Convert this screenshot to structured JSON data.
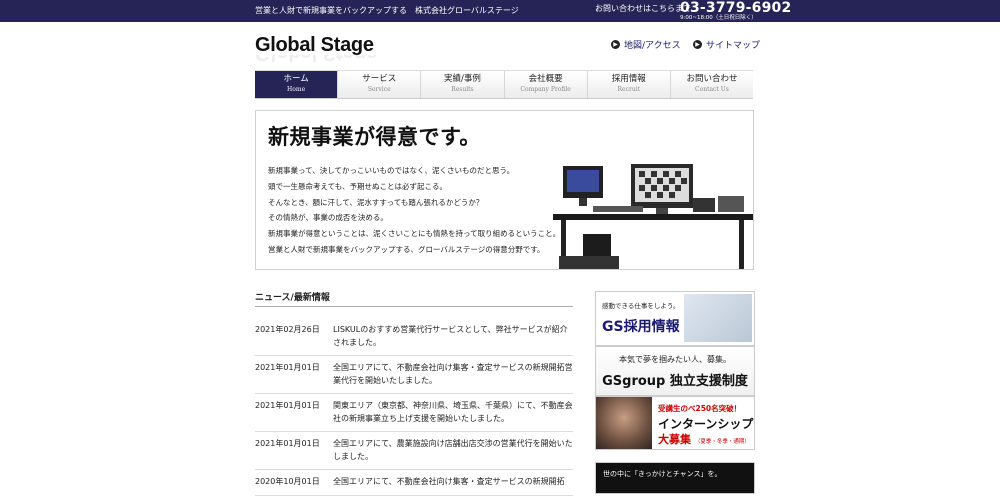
{
  "header": {
    "tagline": "営業と人財で新規事業をバックアップする　株式会社グローバルステージ",
    "contact_label": "お問い合わせはこちらまで",
    "phone": "03-3779-6902",
    "hours": "9:00~18:00（土日祝日除く）"
  },
  "logo": "Global Stage",
  "util_links": [
    {
      "label": "地図/アクセス",
      "icon": "arrow-circle-icon"
    },
    {
      "label": "サイトマップ",
      "icon": "arrow-circle-icon"
    }
  ],
  "nav": [
    {
      "jp": "ホーム",
      "en": "Home",
      "active": true
    },
    {
      "jp": "サービス",
      "en": "Service"
    },
    {
      "jp": "実績/事例",
      "en": "Results"
    },
    {
      "jp": "会社概要",
      "en": "Company Profile"
    },
    {
      "jp": "採用情報",
      "en": "Recruit"
    },
    {
      "jp": "お問い合わせ",
      "en": "Contact Us"
    }
  ],
  "hero": {
    "title": "新規事業が得意です。",
    "lines": [
      "新規事業って、決してかっこいいものではなく、泥くさいものだと思う。",
      "頭で一生懸命考えても、予期せぬことは必ず起こる。",
      "そんなとき、額に汗して、泥水すすっても踏ん張れるかどうか？",
      "その情熱が、事業の成否を決める。",
      "新規事業が得意ということは、泥くさいことにも情熱を持って取り組めるということ。",
      "営業と人財で新規事業をバックアップする、グローバルステージの得意分野です。"
    ]
  },
  "news": {
    "title": "ニュース/最新情報",
    "items": [
      {
        "date": "2021年02月26日",
        "text": "LISKULのおすすめ営業代行サービスとして、弊社サービスが紹介されました。"
      },
      {
        "date": "2021年01月01日",
        "text": "全国エリアにて、不動産会社向け集客・査定サービスの新規開拓営業代行を開始いたしました。"
      },
      {
        "date": "2021年01月01日",
        "text": "関東エリア（東京都、神奈川県、埼玉県、千葉県）にて、不動産会社の新規事業立ち上げ支援を開始いたしました。"
      },
      {
        "date": "2021年01月01日",
        "text": "全国エリアにて、農業施設向け店舗出店交渉の営業代行を開始いたしました。"
      },
      {
        "date": "2020年10月01日",
        "text": "全国エリアにて、不動産会社向け集客・査定サービスの新規開拓"
      }
    ]
  },
  "banners": {
    "recruit": {
      "small": "感動できる仕事をしよう。",
      "big": "GS採用情報"
    },
    "support": {
      "small": "本気で夢を掴みたい人、募集。",
      "big": "GSgroup 独立支援制度"
    },
    "intern": {
      "red": "受講生のべ250名突破！",
      "big": "インターンシップ",
      "big2": "大募集",
      "season": "（夏季・冬季・通期）"
    },
    "chance": {
      "small": "世の中に「きっかけとチャンス」を。"
    }
  }
}
